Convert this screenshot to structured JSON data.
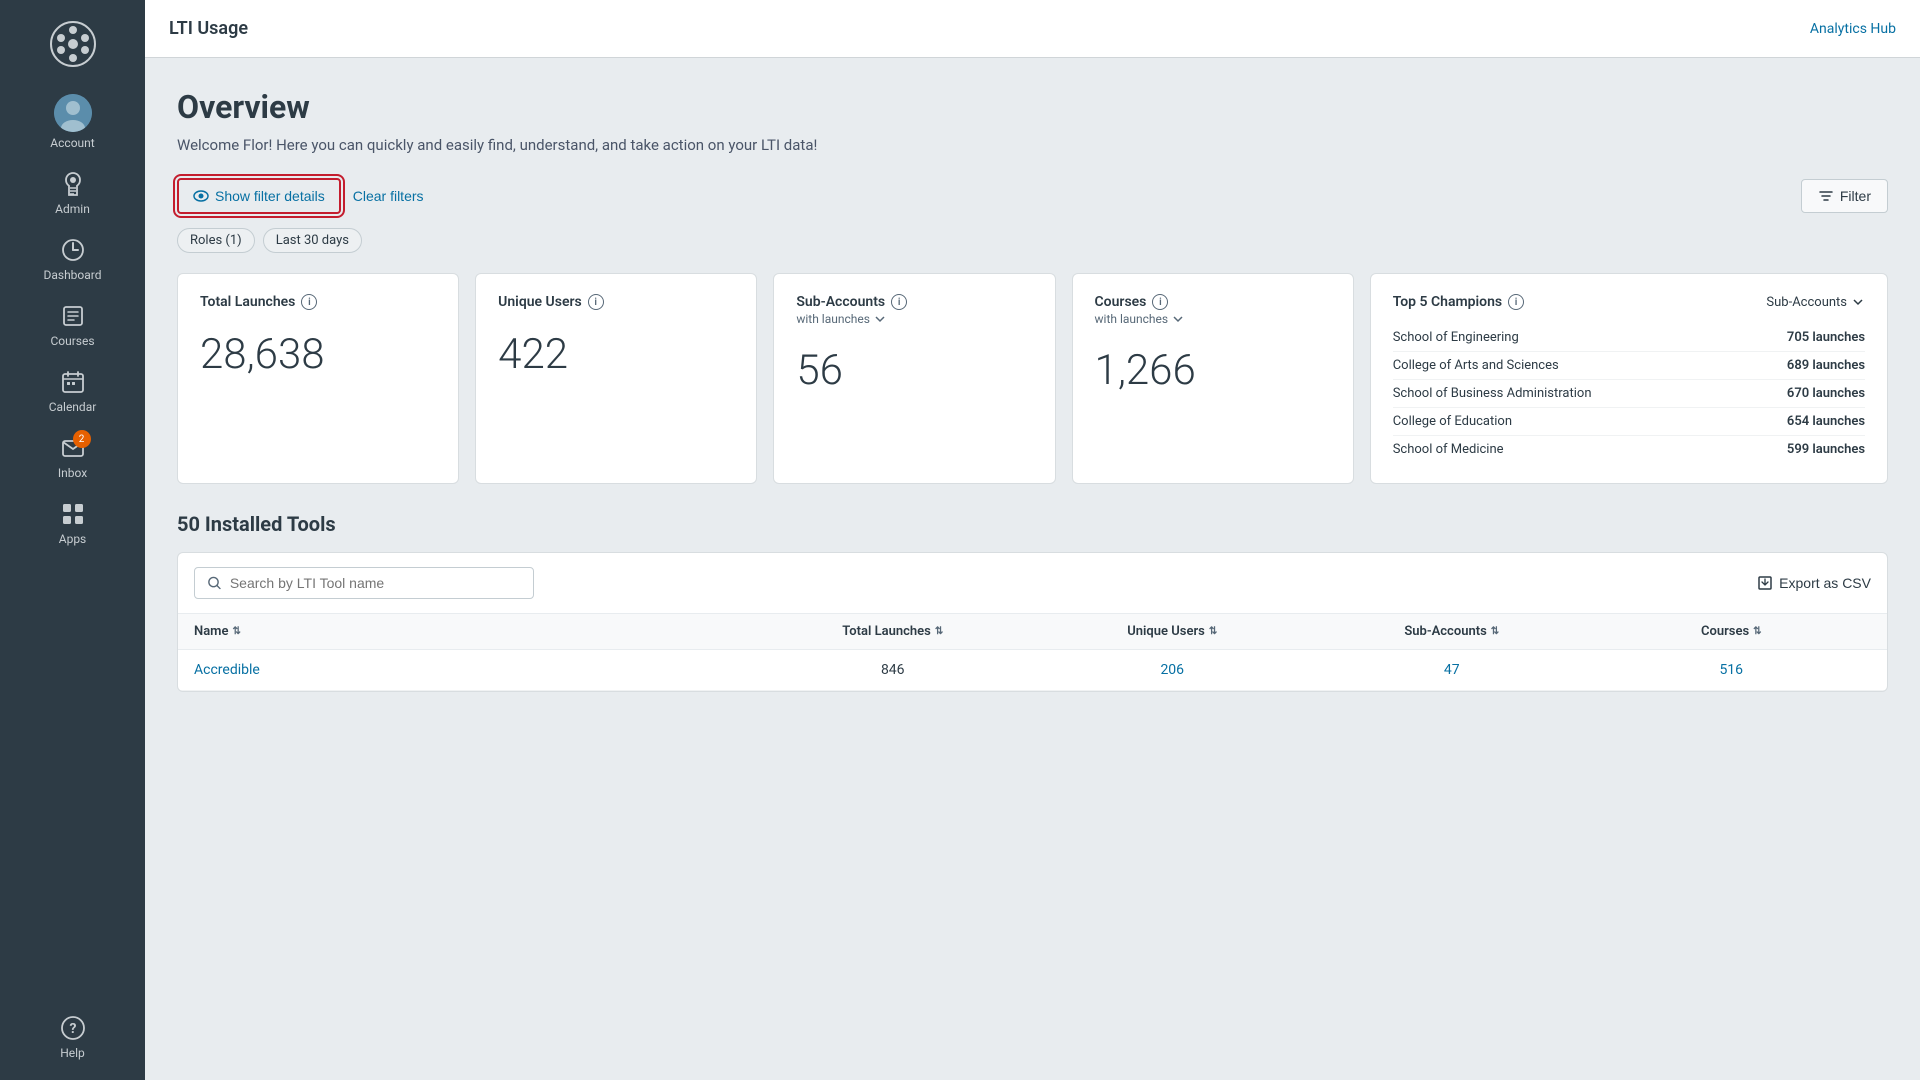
{
  "topbar": {
    "title": "LTI Usage",
    "analytics_hub": "Analytics Hub"
  },
  "sidebar": {
    "logo_alt": "Canvas Logo",
    "items": [
      {
        "id": "account",
        "label": "Account",
        "icon": "account"
      },
      {
        "id": "admin",
        "label": "Admin",
        "icon": "admin"
      },
      {
        "id": "dashboard",
        "label": "Dashboard",
        "icon": "dashboard"
      },
      {
        "id": "courses",
        "label": "Courses",
        "icon": "courses"
      },
      {
        "id": "calendar",
        "label": "Calendar",
        "icon": "calendar"
      },
      {
        "id": "inbox",
        "label": "Inbox",
        "icon": "inbox",
        "badge": "2"
      },
      {
        "id": "apps",
        "label": "Apps",
        "icon": "apps"
      },
      {
        "id": "help",
        "label": "Help",
        "icon": "help"
      }
    ]
  },
  "overview": {
    "title": "Overview",
    "subtitle": "Welcome Flor! Here you can quickly and easily find, understand, and take action on your LTI data!"
  },
  "filters": {
    "show_filter_label": "Show filter details",
    "clear_filters_label": "Clear filters",
    "filter_button_label": "Filter",
    "tags": [
      {
        "label": "Roles (1)"
      },
      {
        "label": "Last 30 days"
      }
    ]
  },
  "stats": {
    "total_launches": {
      "title": "Total Launches",
      "value": "28,638"
    },
    "unique_users": {
      "title": "Unique Users",
      "value": "422"
    },
    "sub_accounts": {
      "title": "Sub-Accounts",
      "subtitle": "with launches",
      "value": "56"
    },
    "courses": {
      "title": "Courses",
      "subtitle": "with launches",
      "value": "1,266"
    },
    "top_champions": {
      "title": "Top 5 Champions",
      "selector": "Sub-Accounts",
      "rows": [
        {
          "name": "School of Engineering",
          "launches": "705 launches"
        },
        {
          "name": "College of Arts and Sciences",
          "launches": "689 launches"
        },
        {
          "name": "School of Business Administration",
          "launches": "670 launches"
        },
        {
          "name": "College of Education",
          "launches": "654 launches"
        },
        {
          "name": "School of Medicine",
          "launches": "599 launches"
        }
      ]
    }
  },
  "tools_section": {
    "title": "50 Installed Tools",
    "search_placeholder": "Search by LTI Tool name",
    "export_label": "Export as CSV",
    "table_headers": [
      {
        "label": "Name",
        "sortable": true
      },
      {
        "label": "Total Launches",
        "sortable": true
      },
      {
        "label": "Unique Users",
        "sortable": true
      },
      {
        "label": "Sub-Accounts",
        "sortable": true
      },
      {
        "label": "Courses",
        "sortable": true
      }
    ],
    "rows": [
      {
        "name": "Accredible",
        "total_launches": "846",
        "unique_users": "206",
        "sub_accounts": "47",
        "courses": "516"
      }
    ]
  }
}
